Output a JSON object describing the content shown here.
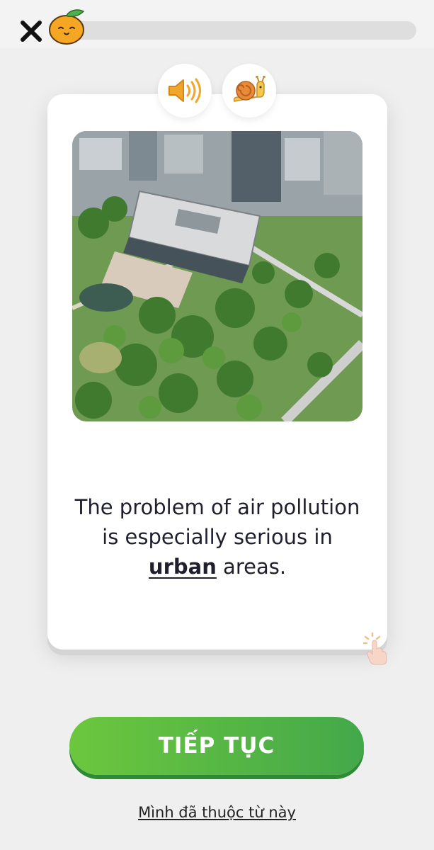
{
  "header": {
    "close_icon": "close-icon",
    "mascot_icon": "orange-mascot-icon",
    "progress": 0.02
  },
  "audio": {
    "normal_icon": "speaker-icon",
    "slow_icon": "snail-icon"
  },
  "card": {
    "image": "aerial-city-park-photo",
    "sentence_before": "The problem of air pollution is especially serious in ",
    "keyword": "urban",
    "sentence_after": " areas.",
    "tap_hint_icon": "tap-hand-icon"
  },
  "actions": {
    "continue_label": "TIẾP TỤC",
    "known_label": "Mình đã thuộc từ này"
  },
  "colors": {
    "background": "#efefef",
    "primary_green": "#5bb945",
    "accent_orange": "#f2a52b"
  }
}
